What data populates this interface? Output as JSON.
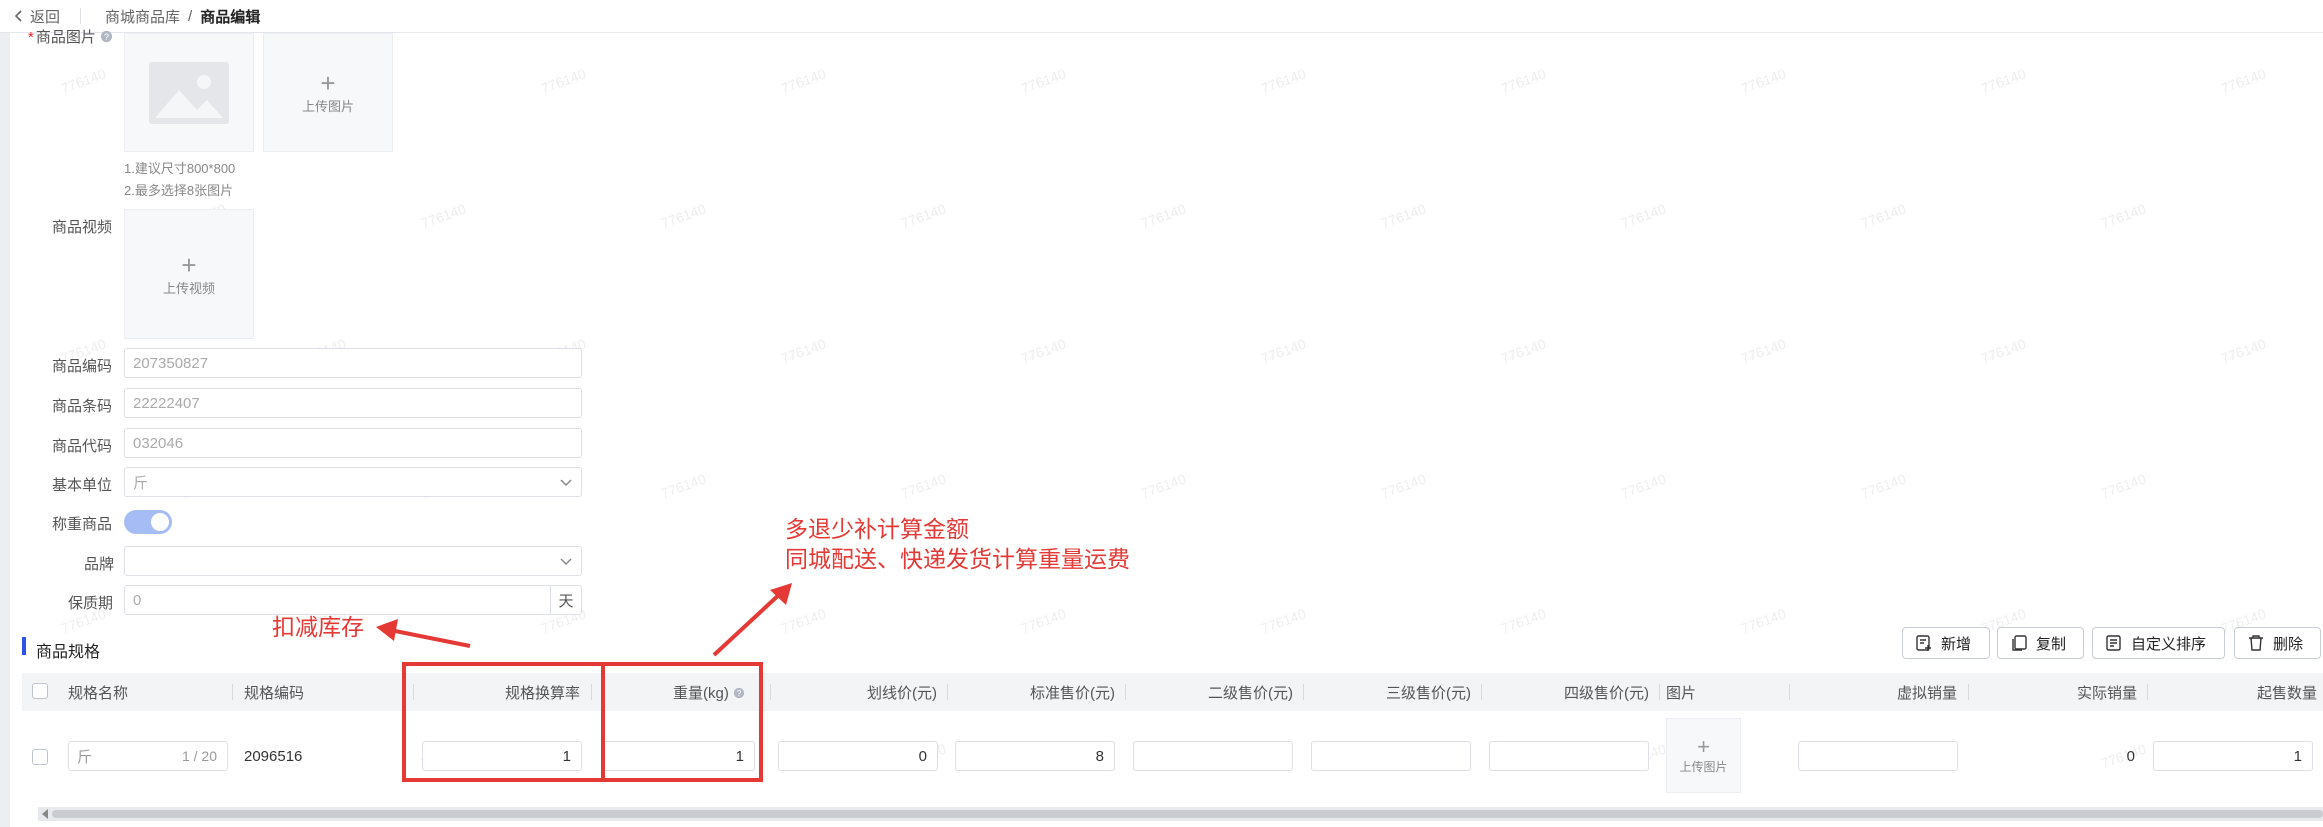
{
  "topbar": {
    "back": "返回",
    "crumb1": "商城商品库",
    "crumb_sep": "/",
    "crumb2": "商品编辑"
  },
  "form": {
    "image_label": "商品图片",
    "upload_image": "上传图片",
    "image_hint1": "1.建议尺寸800*800",
    "image_hint2": "2.最多选择8张图片",
    "video_label": "商品视频",
    "upload_video": "上传视频",
    "code_label": "商品编码",
    "code_value": "207350827",
    "barcode_label": "商品条码",
    "barcode_value": "22222407",
    "product_code_label": "商品代码",
    "product_code_value": "032046",
    "unit_label": "基本单位",
    "unit_value": "斤",
    "weigh_label": "称重商品",
    "brand_label": "品牌",
    "brand_value": "",
    "shelf_label": "保质期",
    "shelf_value": "0",
    "shelf_suffix": "天"
  },
  "spec": {
    "title": "商品规格",
    "buttons": {
      "add": "新增",
      "copy": "复制",
      "sort": "自定义排序",
      "delete": "删除"
    },
    "columns": [
      "规格名称",
      "规格编码",
      "规格换算率",
      "重量(kg)",
      "划线价(元)",
      "标准售价(元)",
      "二级售价(元)",
      "三级售价(元)",
      "四级售价(元)",
      "图片",
      "虚拟销量",
      "实际销量",
      "起售数量"
    ],
    "row": {
      "name": "斤",
      "name_count": "1 / 20",
      "code": "2096516",
      "rate": "1",
      "weight": "1",
      "line_price": "0",
      "std_price": "8",
      "price2": "",
      "price3": "",
      "price4": "",
      "upload_image": "上传图片",
      "virtual_sales": "",
      "actual_sales": "0",
      "min_qty": "1"
    }
  },
  "annotations": {
    "text1_line1": "多退少补计算金额",
    "text1_line2": "同城配送、快递发货计算重量运费",
    "text2": "扣减库存",
    "color": "#e53935"
  },
  "watermark": "776140"
}
